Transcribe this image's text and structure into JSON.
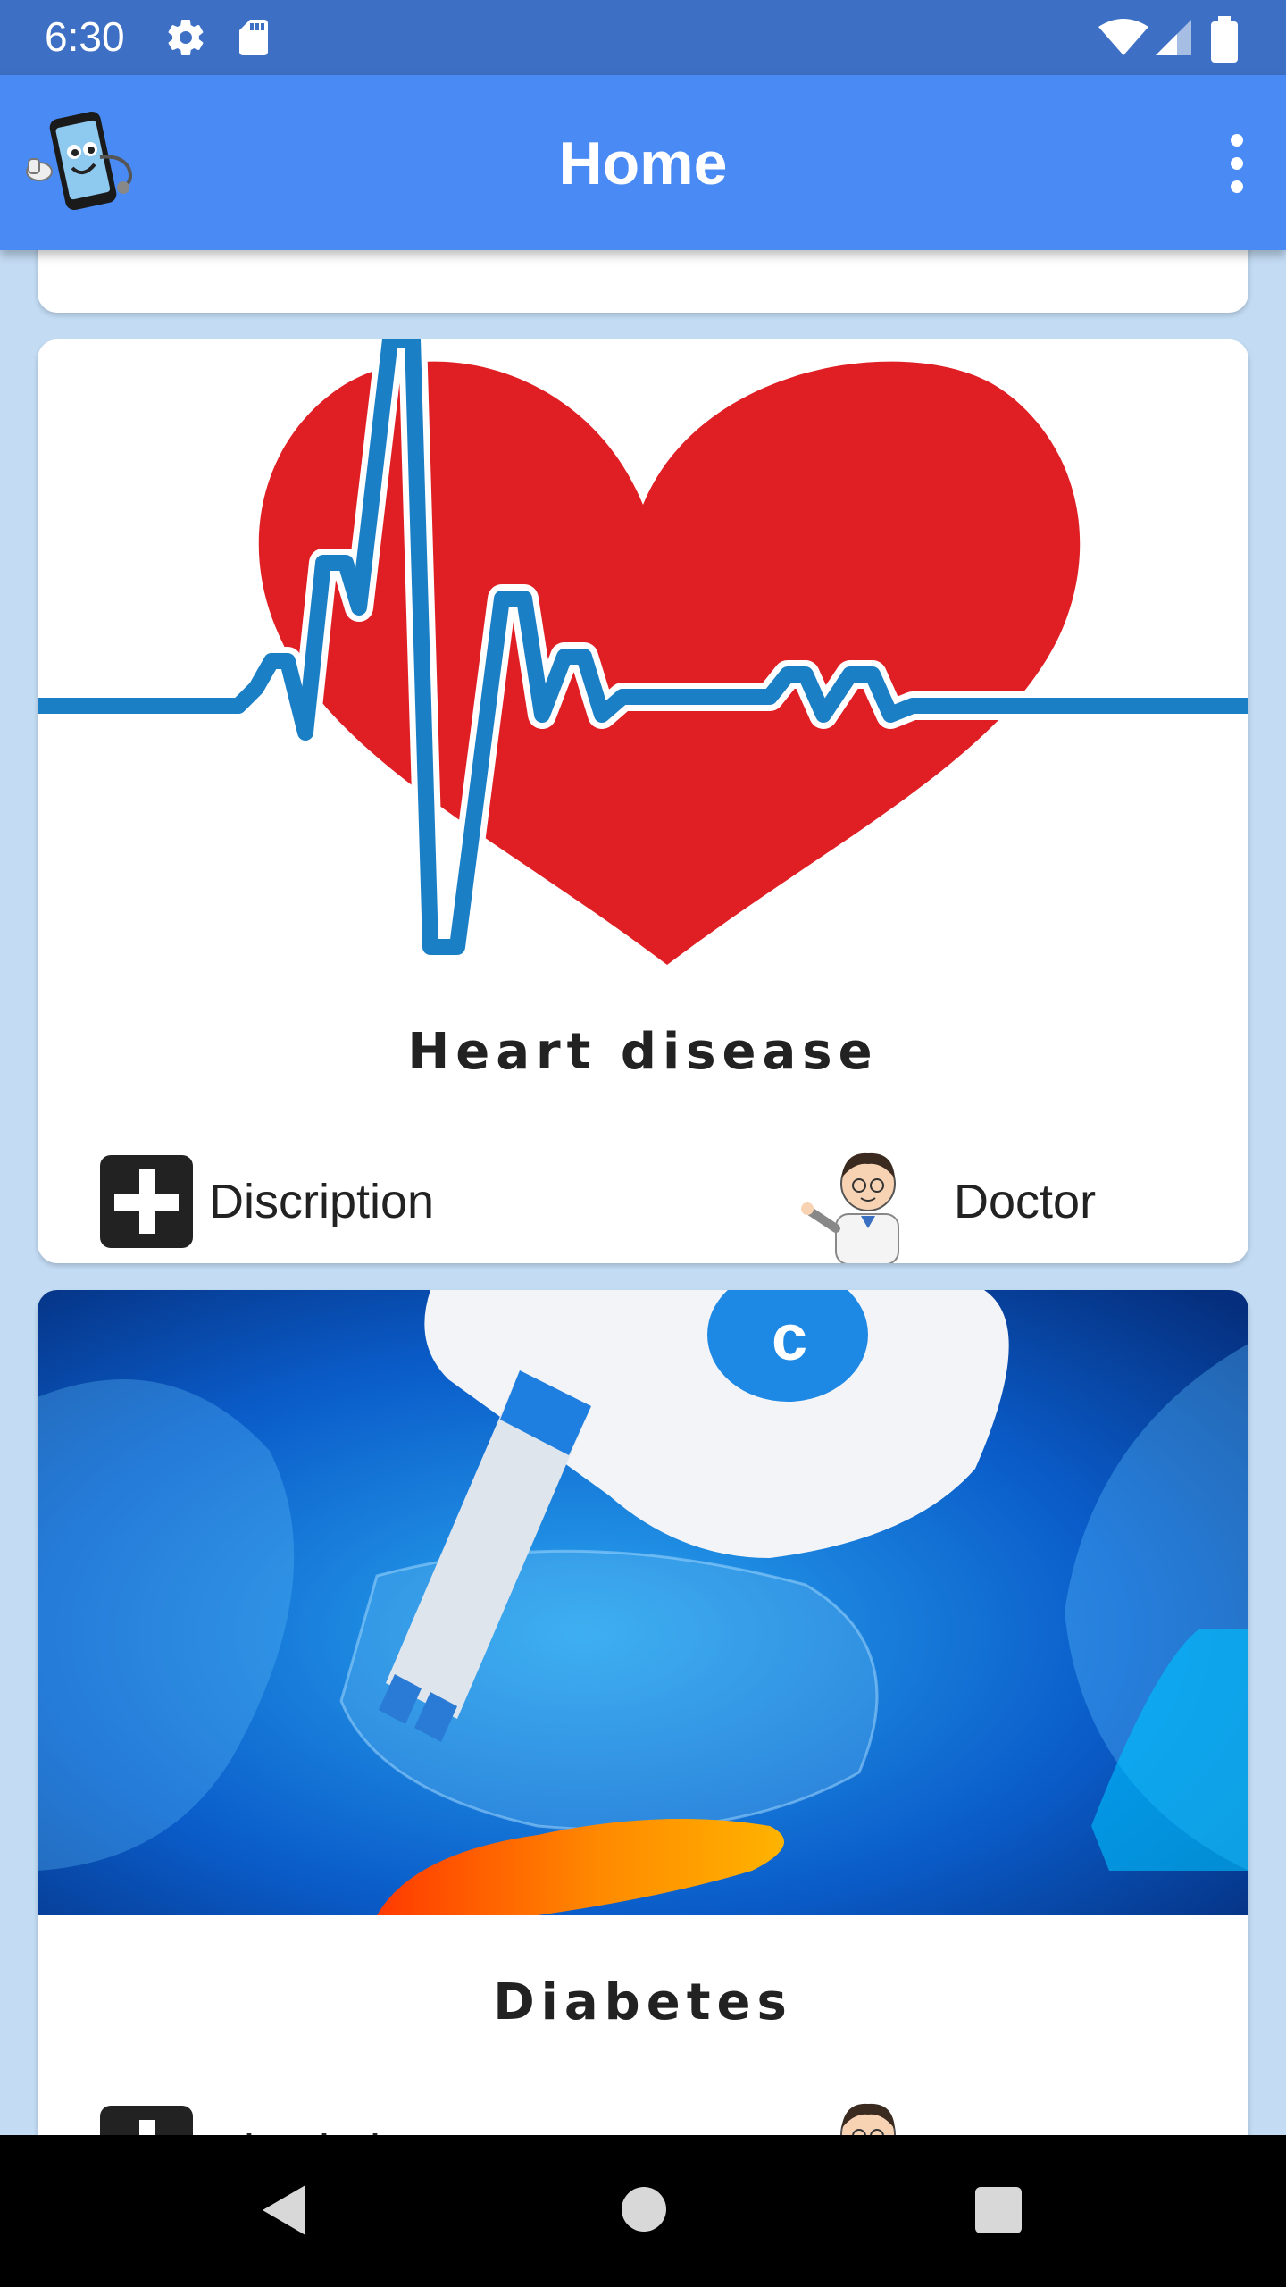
{
  "status_bar": {
    "time": "6:30",
    "icons": [
      "settings-icon",
      "sd-card-icon",
      "wifi-icon",
      "signal-icon",
      "battery-icon"
    ]
  },
  "app_bar": {
    "title": "Home",
    "logo_icon": "doctor-phone-logo",
    "menu_icon": "more-vert-icon"
  },
  "cards": [
    {
      "title": "Heart disease",
      "image": "heart-ecg-image",
      "actions": {
        "description_label": "Discription",
        "doctor_label": "Doctor"
      }
    },
    {
      "title": "Diabetes",
      "image": "diabetes-glucometer-image",
      "actions": {
        "description_label": "Discription",
        "doctor_label": "Doctor"
      }
    }
  ],
  "colors": {
    "status_bar": "#3d6fc4",
    "app_bar": "#4a8af4",
    "background": "#c3dcf4",
    "heart_red": "#e01f25",
    "ecg_blue": "#1b7fc6"
  }
}
